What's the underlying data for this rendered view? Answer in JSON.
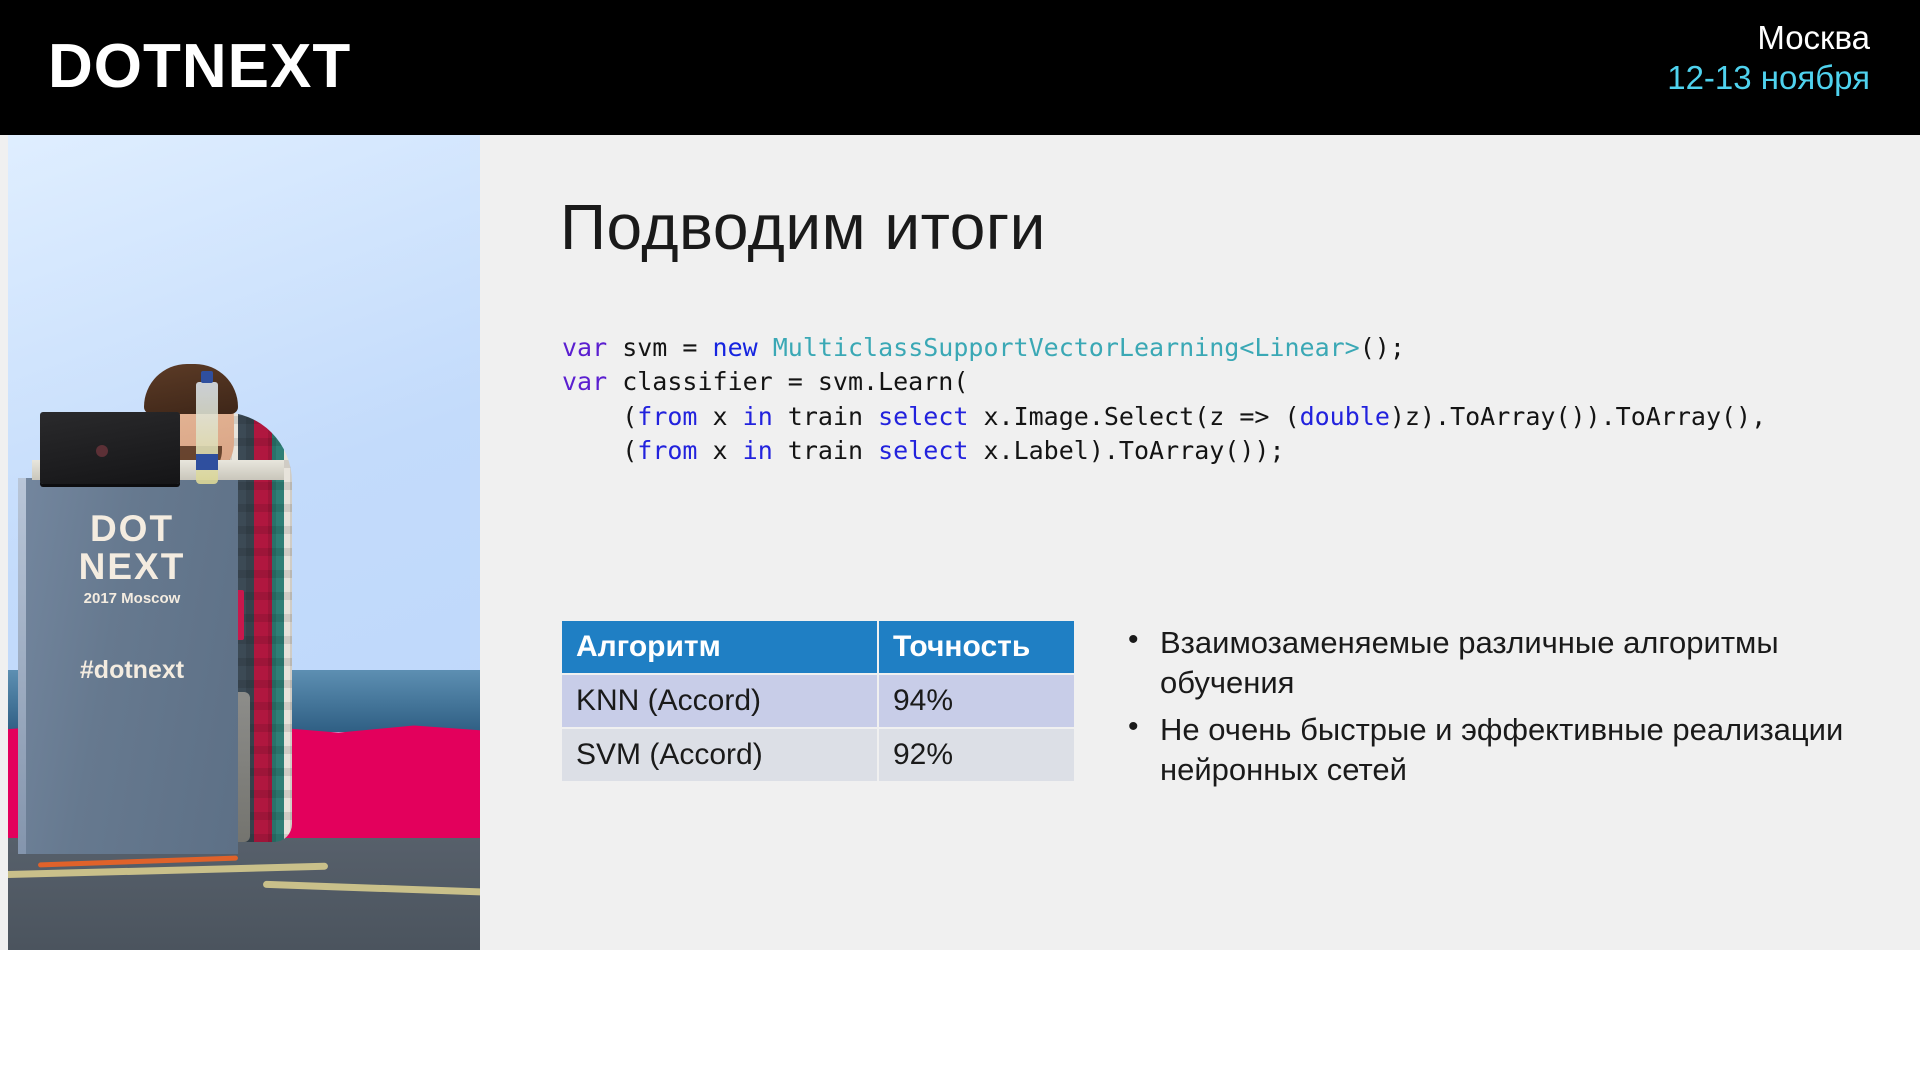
{
  "header": {
    "logo": "DOTNEXT",
    "city": "Москва",
    "dates": "12-13 ноября"
  },
  "photo": {
    "podium_line1": "DOT",
    "podium_line2": "NEXT",
    "podium_year": "2017 Moscow",
    "podium_hashtag": "#dotnext"
  },
  "slide": {
    "title": "Подводим итоги",
    "code": {
      "line1": {
        "t1": "var",
        "t2": " svm = ",
        "t3": "new",
        "t4": " ",
        "t5": "MulticlassSupportVectorLearning<Linear>",
        "t6": "();"
      },
      "line2": {
        "t1": "var",
        "t2": " classifier = svm.Learn("
      },
      "line3": {
        "t1": "    (",
        "t2": "from",
        "t3": " x ",
        "t4": "in",
        "t5": " train ",
        "t6": "select",
        "t7": " x.Image.Select(z => (",
        "t8": "double",
        "t9": ")z).ToArray()).ToArray(),"
      },
      "line4": {
        "t1": "    (",
        "t2": "from",
        "t3": " x ",
        "t4": "in",
        "t5": " train ",
        "t6": "select",
        "t7": " x.Label).ToArray());"
      }
    },
    "table": {
      "headers": [
        "Алгоритм",
        "Точность"
      ],
      "rows": [
        {
          "algorithm": "KNN (Accord)",
          "accuracy": "94%"
        },
        {
          "algorithm": "SVM (Accord)",
          "accuracy": "92%"
        }
      ]
    },
    "bullets": [
      "Взаимозаменяемые различные алгоритмы обучения",
      "Не очень быстрые и эффективные реализации нейронных сетей"
    ]
  },
  "colors": {
    "accent_cyan": "#4fd2ee",
    "table_header_blue": "#1f7fc4",
    "slide_bg": "#f0f0f0",
    "topbar_bg": "#000000"
  }
}
